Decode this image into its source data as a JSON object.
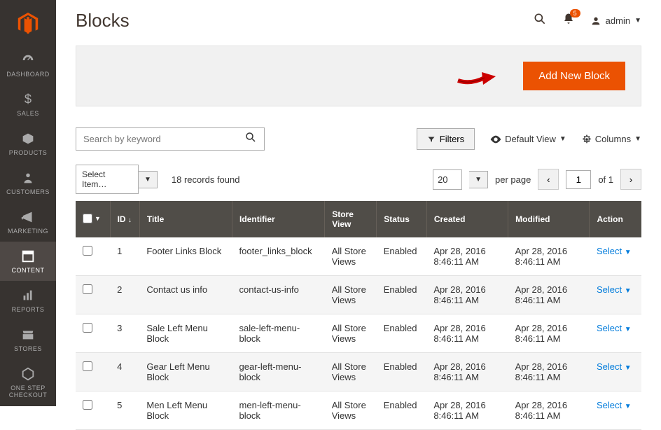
{
  "sidebar": {
    "items": [
      {
        "label": "DASHBOARD"
      },
      {
        "label": "SALES"
      },
      {
        "label": "PRODUCTS"
      },
      {
        "label": "CUSTOMERS"
      },
      {
        "label": "MARKETING"
      },
      {
        "label": "CONTENT"
      },
      {
        "label": "REPORTS"
      },
      {
        "label": "STORES"
      },
      {
        "label": "ONE STEP CHECKOUT"
      }
    ]
  },
  "header": {
    "title": "Blocks",
    "notification_count": "5",
    "username": "admin"
  },
  "actions": {
    "add_button": "Add New Block"
  },
  "toolbar": {
    "search_placeholder": "Search by keyword",
    "filters": "Filters",
    "default_view": "Default View",
    "columns": "Columns",
    "select_items": "Select Item…",
    "records_found": "18 records found",
    "page_size": "20",
    "per_page_label": "per page",
    "current_page": "1",
    "of_label": "of 1"
  },
  "table": {
    "headers": {
      "id": "ID",
      "title": "Title",
      "identifier": "Identifier",
      "store_view": "Store View",
      "status": "Status",
      "created": "Created",
      "modified": "Modified",
      "action": "Action"
    },
    "action_label": "Select",
    "rows": [
      {
        "id": "1",
        "title": "Footer Links Block",
        "identifier": "footer_links_block",
        "store_view": "All Store Views",
        "status": "Enabled",
        "created": "Apr 28, 2016 8:46:11 AM",
        "modified": "Apr 28, 2016 8:46:11 AM"
      },
      {
        "id": "2",
        "title": "Contact us info",
        "identifier": "contact-us-info",
        "store_view": "All Store Views",
        "status": "Enabled",
        "created": "Apr 28, 2016 8:46:11 AM",
        "modified": "Apr 28, 2016 8:46:11 AM"
      },
      {
        "id": "3",
        "title": "Sale Left Menu Block",
        "identifier": "sale-left-menu-block",
        "store_view": "All Store Views",
        "status": "Enabled",
        "created": "Apr 28, 2016 8:46:11 AM",
        "modified": "Apr 28, 2016 8:46:11 AM"
      },
      {
        "id": "4",
        "title": "Gear Left Menu Block",
        "identifier": "gear-left-menu-block",
        "store_view": "All Store Views",
        "status": "Enabled",
        "created": "Apr 28, 2016 8:46:11 AM",
        "modified": "Apr 28, 2016 8:46:11 AM"
      },
      {
        "id": "5",
        "title": "Men Left Menu Block",
        "identifier": "men-left-menu-block",
        "store_view": "All Store Views",
        "status": "Enabled",
        "created": "Apr 28, 2016 8:46:11 AM",
        "modified": "Apr 28, 2016 8:46:11 AM"
      }
    ]
  }
}
